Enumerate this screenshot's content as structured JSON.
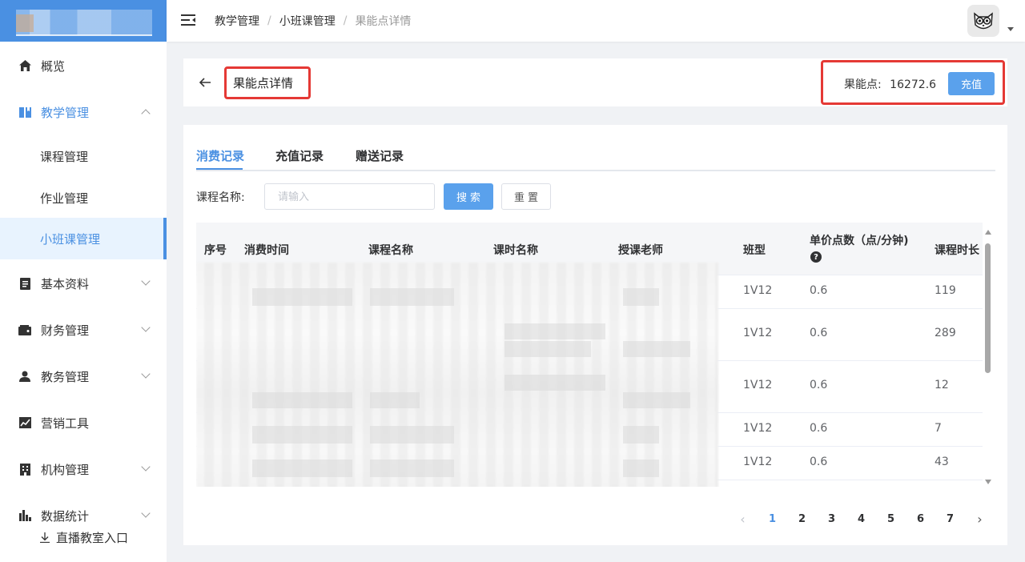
{
  "sidebar": {
    "items": [
      {
        "label": "概览",
        "icon": "home-icon"
      },
      {
        "label": "教学管理",
        "icon": "book-icon"
      },
      {
        "label": "基本资料",
        "icon": "document-icon"
      },
      {
        "label": "财务管理",
        "icon": "wallet-icon"
      },
      {
        "label": "教务管理",
        "icon": "user-icon"
      },
      {
        "label": "营销工具",
        "icon": "trend-chart-icon"
      },
      {
        "label": "机构管理",
        "icon": "building-icon"
      },
      {
        "label": "数据统计",
        "icon": "bar-chart-icon"
      }
    ],
    "sub_items": [
      {
        "label": "课程管理"
      },
      {
        "label": "作业管理"
      },
      {
        "label": "小班课管理"
      }
    ],
    "live_entry": "直播教室入口"
  },
  "header": {
    "breadcrumb": [
      "教学管理",
      "小班课管理",
      "果能点详情"
    ]
  },
  "title_card": {
    "title": "果能点详情",
    "balance_label": "果能点:",
    "balance_value": "16272.6",
    "recharge_label": "充值"
  },
  "tabs": [
    {
      "label": "消费记录",
      "active": true
    },
    {
      "label": "充值记录",
      "active": false
    },
    {
      "label": "赠送记录",
      "active": false
    }
  ],
  "filter": {
    "label": "课程名称:",
    "placeholder": "请输入",
    "search_label": "搜索",
    "reset_label": "重置"
  },
  "table": {
    "columns": [
      "序号",
      "消费时间",
      "课程名称",
      "课时名称",
      "授课老师",
      "班型",
      "单价点数（点/分钟)",
      "课程时长"
    ],
    "rows": [
      {
        "class_type": "1V12",
        "unit_price": "0.6",
        "duration": "119"
      },
      {
        "class_type": "1V12",
        "unit_price": "0.6",
        "duration": "289"
      },
      {
        "class_type": "1V12",
        "unit_price": "0.6",
        "duration": "12"
      },
      {
        "class_type": "1V12",
        "unit_price": "0.6",
        "duration": "7"
      },
      {
        "class_type": "1V12",
        "unit_price": "0.6",
        "duration": "43"
      }
    ]
  },
  "pagination": {
    "pages": [
      "1",
      "2",
      "3",
      "4",
      "5",
      "6",
      "7"
    ],
    "current": "1"
  },
  "colors": {
    "accent": "#4a90e2",
    "highlight_border": "#e53935"
  }
}
